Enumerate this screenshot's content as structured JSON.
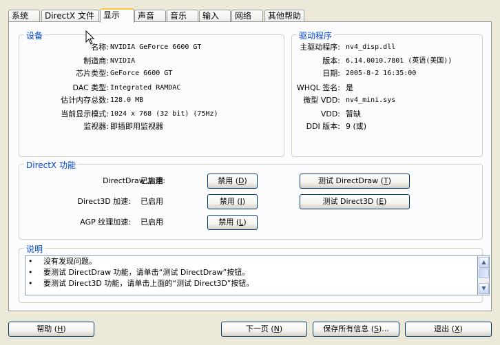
{
  "tabs": [
    {
      "label": "系统"
    },
    {
      "label": "DirectX 文件"
    },
    {
      "label": "显示"
    },
    {
      "label": "声音"
    },
    {
      "label": "音乐"
    },
    {
      "label": "输入"
    },
    {
      "label": "网络"
    },
    {
      "label": "其他帮助"
    }
  ],
  "device": {
    "title": "设备",
    "rows": [
      {
        "label": "名称:",
        "value": "NVIDIA GeForce 6600 GT"
      },
      {
        "label": "制造商:",
        "value": "NVIDIA"
      },
      {
        "label": "芯片类型:",
        "value": "GeForce 6600 GT"
      },
      {
        "label": "DAC 类型:",
        "value": "Integrated RAMDAC"
      },
      {
        "label": "估计内存总数:",
        "value": "128.0 MB"
      },
      {
        "label": "当前显示模式:",
        "value": "1024 x 768 (32 bit) (75Hz)"
      },
      {
        "label": "监视器:",
        "value": "即插即用监视器"
      }
    ]
  },
  "driver": {
    "title": "驱动程序",
    "rows": [
      {
        "label": "主驱动程序:",
        "value": "nv4_disp.dll"
      },
      {
        "label": "版本:",
        "value": "6.14.0010.7801 (英语(美国))"
      },
      {
        "label": "日期:",
        "value": "2005-8-2 16:35:00"
      },
      {
        "label": "WHQL 签名:",
        "value": "是"
      },
      {
        "label": "微型 VDD:",
        "value": "nv4_mini.sys"
      },
      {
        "label": "VDD:",
        "value": "暂缺"
      },
      {
        "label": "DDI 版本:",
        "value": "9 (或)"
      }
    ]
  },
  "directx": {
    "title": "DirectX 功能",
    "rows": [
      {
        "label": "DirectDraw 加速:",
        "status": "已启用",
        "disable_btn": "禁用 (",
        "disable_key": "D",
        "test_btn": "测试 DirectDraw (",
        "test_key": "T"
      },
      {
        "label": "Direct3D 加速:",
        "status": "已启用",
        "disable_btn": "禁用 (",
        "disable_key": "I",
        "test_btn": "测试 Direct3D (",
        "test_key": "E"
      },
      {
        "label": "AGP 纹理加速:",
        "status": "已启用",
        "disable_btn": "禁用 (",
        "disable_key": "L"
      }
    ]
  },
  "notes": {
    "title": "说明",
    "items": [
      "没有发现问题。",
      "要测试 DirectDraw 功能，请单击“测试 DirectDraw”按钮。",
      "要测试 Direct3D 功能，请单击上面的“测试 Direct3D”按钮。"
    ],
    "bullet": "•"
  },
  "footer": {
    "help": {
      "label": "帮助 (",
      "key": "H"
    },
    "next": {
      "label": "下一页 (",
      "key": "N"
    },
    "save": {
      "label": "保存所有信息 (",
      "key": "S",
      "suffix": ")..."
    },
    "exit": {
      "label": "退出 (",
      "key": "X"
    }
  },
  "colors": {
    "group_title": "#0046d5",
    "active_tab_border": "#ffc83c",
    "background": "#ece9d8"
  }
}
